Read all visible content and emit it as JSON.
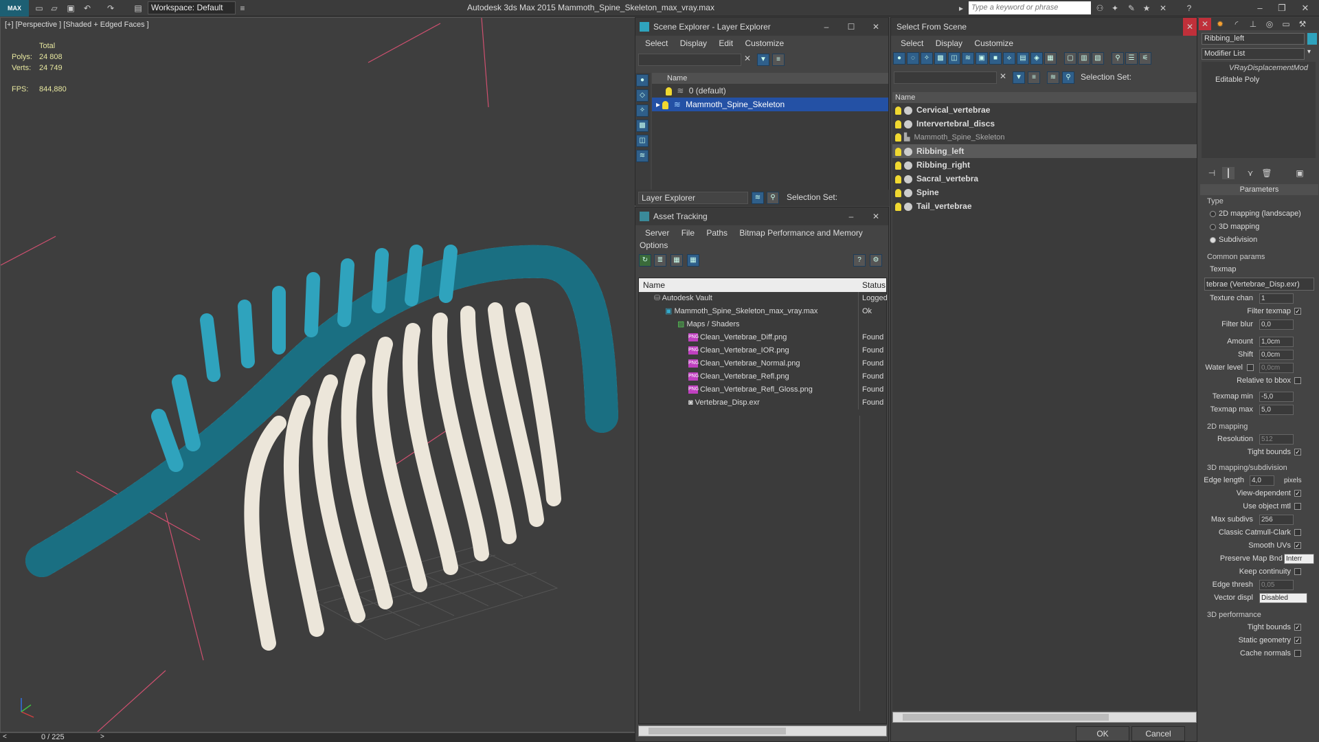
{
  "titlebar": {
    "logo": "MAX",
    "workspace": "Workspace: Default",
    "app_title": "Autodesk 3ds Max  2015    Mammoth_Spine_Skeleton_max_vray.max",
    "search_placeholder": "Type a keyword or phrase"
  },
  "viewport": {
    "label": "[+] [Perspective ] [Shaded + Edged Faces ]",
    "stats_header": "Total",
    "polys_label": "Polys:",
    "polys_value": "24 808",
    "verts_label": "Verts:",
    "verts_value": "24 749",
    "fps_label": "FPS:",
    "fps_value": "844,880",
    "timeline": "0 / 225",
    "colors": {
      "mesh_teal": "#2fa3bd",
      "bone": "#ece6da",
      "background": "#3e3e3e"
    }
  },
  "layer_explorer": {
    "title": "Scene Explorer - Layer Explorer",
    "menu": [
      "Select",
      "Display",
      "Edit",
      "Customize"
    ],
    "column": "Name",
    "layers": [
      "0 (default)",
      "Mammoth_Spine_Skeleton"
    ],
    "footer_dropdown": "Layer Explorer",
    "selection_set_label": "Selection Set:"
  },
  "asset_tracking": {
    "title": "Asset Tracking",
    "menu": [
      "Server",
      "File",
      "Paths",
      "Bitmap Performance and Memory"
    ],
    "menu2": "Options",
    "col_name": "Name",
    "col_status": "Status",
    "rows": [
      {
        "name": "Autodesk Vault",
        "status": "Logged"
      },
      {
        "name": "Mammoth_Spine_Skeleton_max_vray.max",
        "status": "Ok"
      },
      {
        "name": "Maps / Shaders",
        "status": ""
      },
      {
        "name": "Clean_Vertebrae_Diff.png",
        "status": "Found"
      },
      {
        "name": "Clean_Vertebrae_IOR.png",
        "status": "Found"
      },
      {
        "name": "Clean_Vertebrae_Normal.png",
        "status": "Found"
      },
      {
        "name": "Clean_Vertebrae_Refl.png",
        "status": "Found"
      },
      {
        "name": "Clean_Vertebrae_Refl_Gloss.png",
        "status": "Found"
      },
      {
        "name": "Vertebrae_Disp.exr",
        "status": "Found"
      }
    ]
  },
  "select_from_scene": {
    "title": "Select From Scene",
    "menu": [
      "Select",
      "Display",
      "Customize"
    ],
    "selection_set_label": "Selection Set:",
    "column": "Name",
    "objects": [
      "Cervical_vertebrae",
      "Intervertebral_discs",
      "Mammoth_Spine_Skeleton",
      "Ribbing_left",
      "Ribbing_right",
      "Sacral_vertebra",
      "Spine",
      "Tail_vertebrae"
    ],
    "ok": "OK",
    "cancel": "Cancel"
  },
  "command_panel": {
    "object_name": "Ribbing_left",
    "modifier_list": "Modifier List",
    "stack": [
      "VRayDisplacementMod",
      "Editable Poly"
    ],
    "rollout": "Parameters",
    "type_label": "Type",
    "types": [
      "2D mapping (landscape)",
      "3D mapping",
      "Subdivision"
    ],
    "common_params": "Common params",
    "texmap_label": "Texmap",
    "texmap_value": "tebrae (Vertebrae_Disp.exr)",
    "texture_chan": "1",
    "filter_blur": "0,0",
    "amount": "1,0cm",
    "shift": "0,0cm",
    "water_level": "0,0cm",
    "texmap_min": "-5,0",
    "texmap_max": "5,0",
    "mapping2d": "2D mapping",
    "resolution": "512",
    "mapping3d": "3D mapping/subdivision",
    "edge_length": "4,0",
    "pixels": "pixels",
    "max_subdivs": "256",
    "preserve_map": "Interr",
    "edge_thresh": "0,05",
    "vector_displ": "Disabled",
    "perf": "3D performance",
    "labels": {
      "texture_chan": "Texture chan",
      "filter_texmap": "Filter texmap",
      "filter_blur": "Filter blur",
      "amount": "Amount",
      "shift": "Shift",
      "water_level": "Water level",
      "relative_bbox": "Relative to bbox",
      "texmap_min": "Texmap min",
      "texmap_max": "Texmap max",
      "resolution": "Resolution",
      "tight_bounds": "Tight bounds",
      "edge_length": "Edge length",
      "view_dependent": "View-dependent",
      "use_object_mtl": "Use object mtl",
      "max_subdivs": "Max subdivs",
      "catmull": "Classic Catmull-Clark",
      "smooth_uvs": "Smooth UVs",
      "preserve_map": "Preserve Map Bnd",
      "keep_continuity": "Keep continuity",
      "edge_thresh": "Edge thresh",
      "vector_displ": "Vector displ",
      "tight_bounds2": "Tight bounds",
      "static_geometry": "Static geometry",
      "cache_normals": "Cache normals"
    }
  }
}
